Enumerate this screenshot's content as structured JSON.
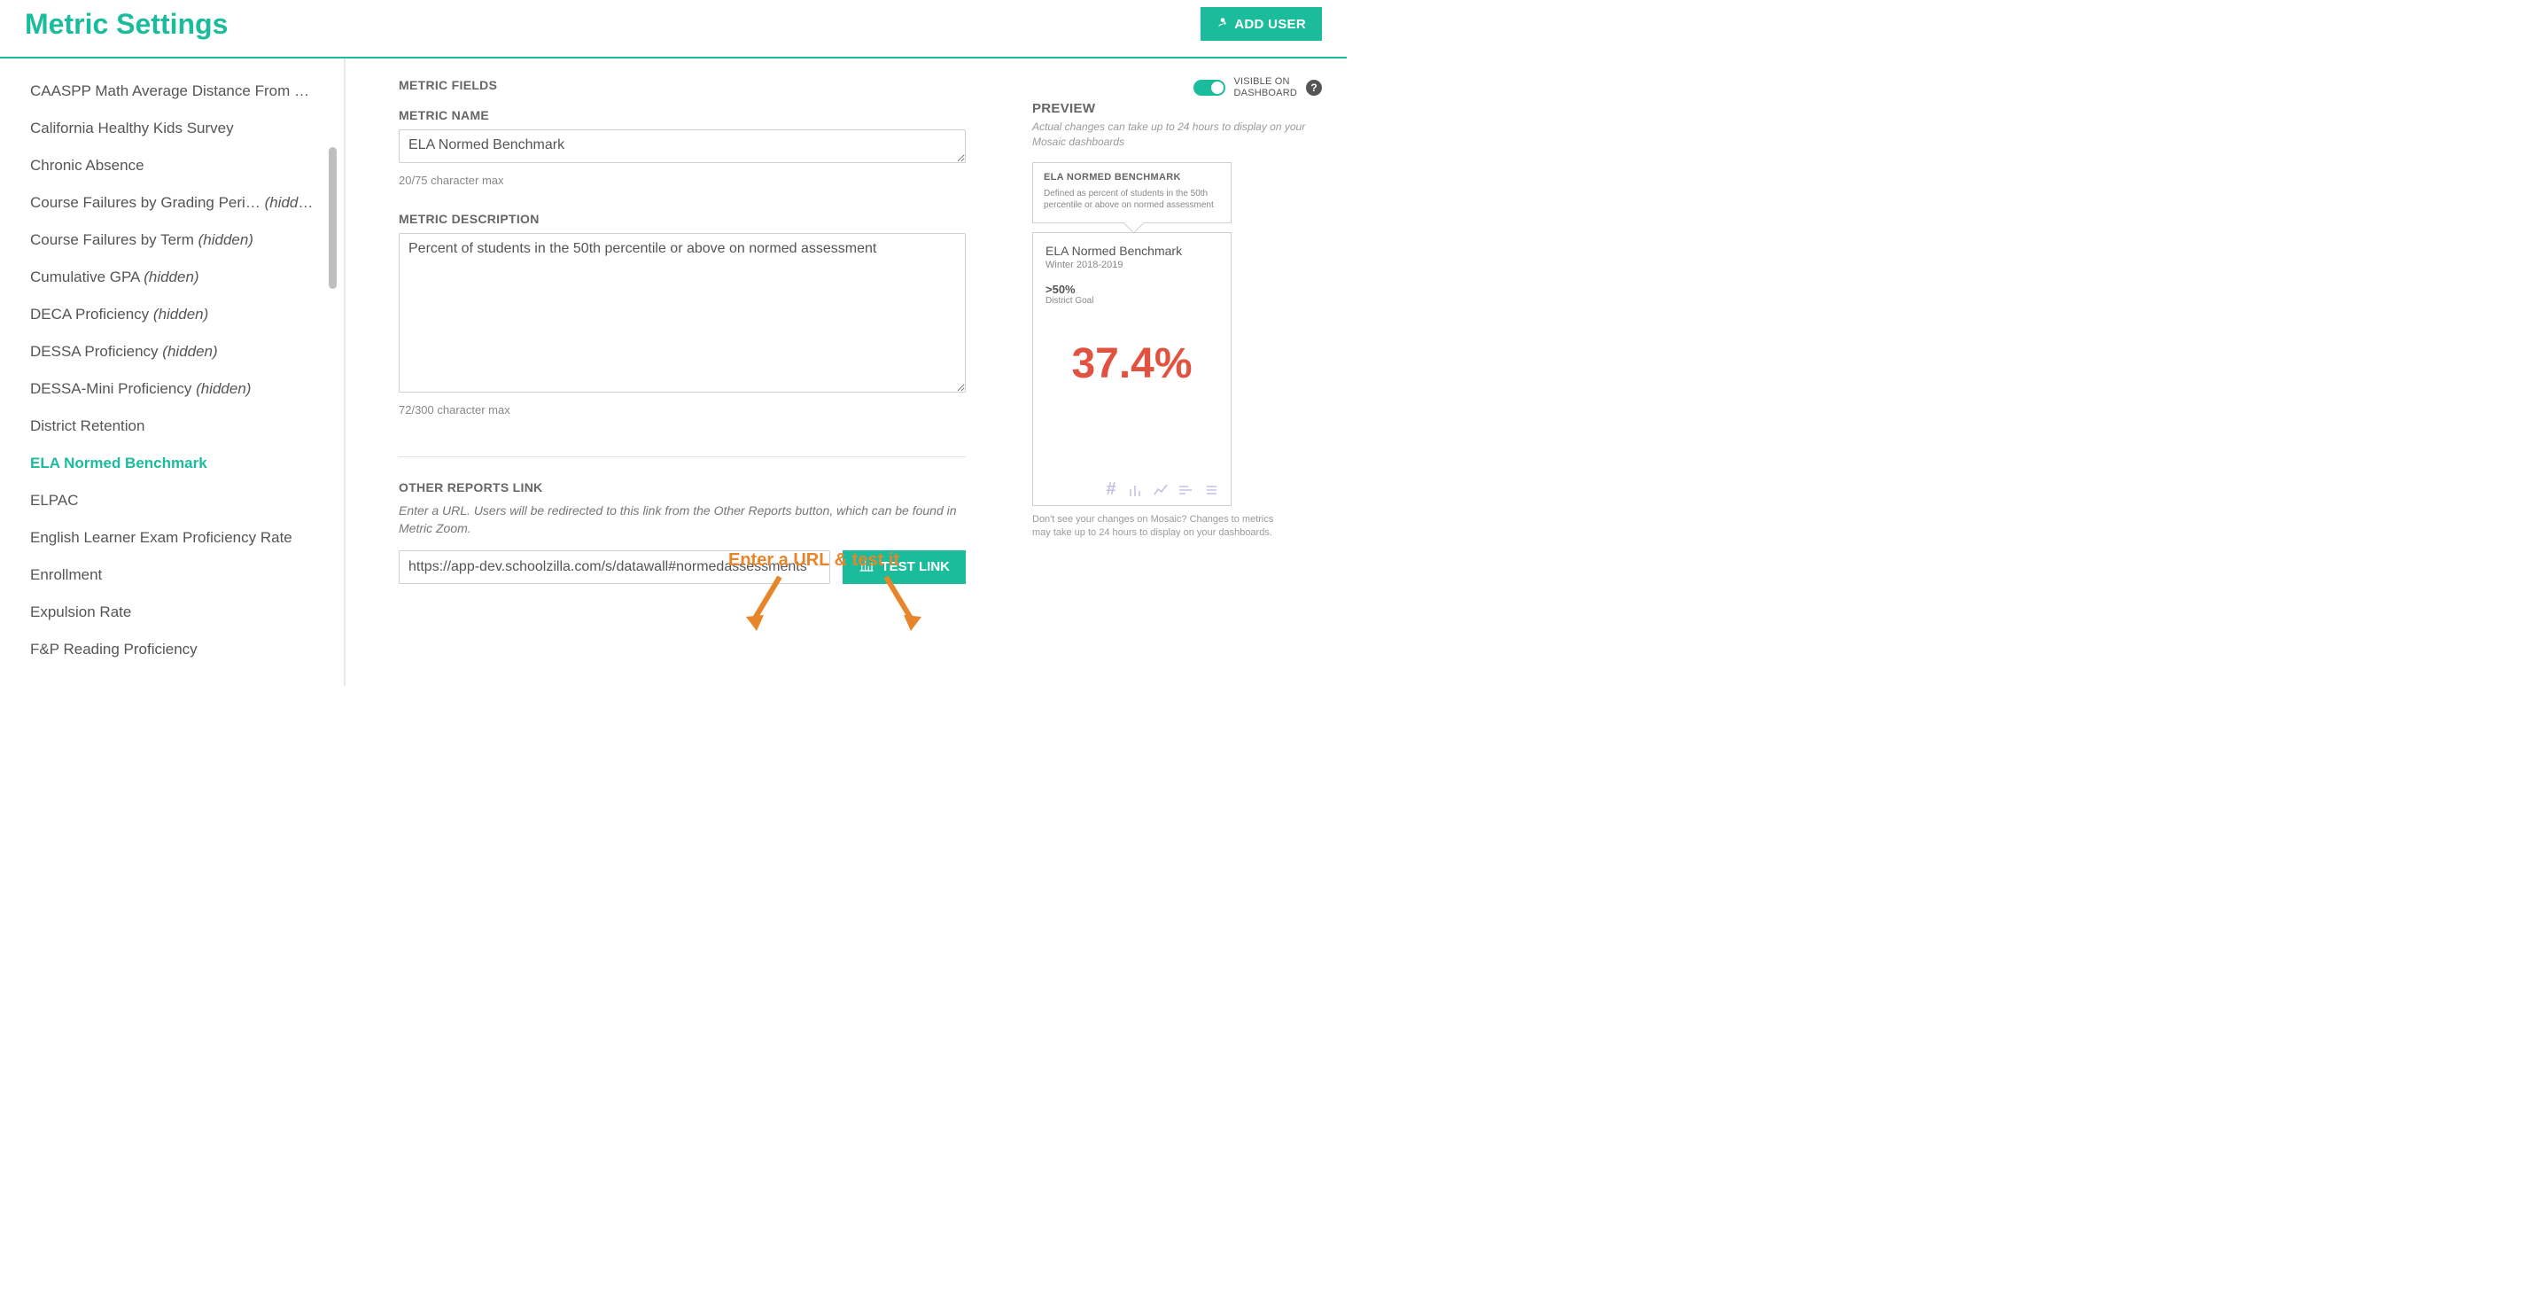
{
  "header": {
    "title": "Metric Settings",
    "add_user_label": "ADD USER"
  },
  "sidebar": {
    "items": [
      {
        "name": "CAASPP Math Average Distance From …",
        "hidden": false
      },
      {
        "name": "California Healthy Kids Survey",
        "hidden": false
      },
      {
        "name": "Chronic Absence",
        "hidden": false
      },
      {
        "name": "Course Failures by Grading Peri…",
        "hidden": true
      },
      {
        "name": "Course Failures by Term",
        "hidden": true
      },
      {
        "name": "Cumulative GPA",
        "hidden": true
      },
      {
        "name": "DECA Proficiency",
        "hidden": true
      },
      {
        "name": "DESSA Proficiency",
        "hidden": true
      },
      {
        "name": "DESSA-Mini Proficiency",
        "hidden": true
      },
      {
        "name": "District Retention",
        "hidden": false
      },
      {
        "name": "ELA Normed Benchmark",
        "hidden": false,
        "active": true
      },
      {
        "name": "ELPAC",
        "hidden": false
      },
      {
        "name": "English Learner Exam Proficiency Rate",
        "hidden": false
      },
      {
        "name": "Enrollment",
        "hidden": false
      },
      {
        "name": "Expulsion Rate",
        "hidden": false
      },
      {
        "name": "F&P Reading Proficiency",
        "hidden": false
      }
    ],
    "hidden_suffix": "(hidden)"
  },
  "form": {
    "section_label": "METRIC FIELDS",
    "name_label": "METRIC NAME",
    "name_value": "ELA Normed Benchmark",
    "name_hint": "20/75 character max",
    "desc_label": "METRIC DESCRIPTION",
    "desc_value": "Percent of students in the 50th percentile or above on normed assessment",
    "desc_hint": "72/300 character max",
    "link_label": "OTHER REPORTS LINK",
    "link_help": "Enter a URL. Users will be redirected to this link from the Other Reports button, which can be found in Metric Zoom.",
    "link_value": "https://app-dev.schoolzilla.com/s/datawall#normedassessments",
    "test_link_label": "TEST LINK"
  },
  "preview": {
    "toggle_label_line1": "VISIBLE ON",
    "toggle_label_line2": "DASHBOARD",
    "title": "PREVIEW",
    "sub": "Actual changes can take up to 24 hours to display on your Mosaic dashboards",
    "tooltip_title": "ELA NORMED BENCHMARK",
    "tooltip_desc": "Defined as percent of students in the 50th percentile or above on normed assessment",
    "card_title": "ELA Normed Benchmark",
    "card_term": "Winter 2018-2019",
    "card_goal_val": ">50%",
    "card_goal_lbl": "District Goal",
    "card_value": "37.4%",
    "footnote": "Don't see your changes on Mosaic? Changes to metrics may take up to 24 hours to display on your dashboards."
  },
  "annotation": {
    "text": "Enter a URL & test it"
  }
}
